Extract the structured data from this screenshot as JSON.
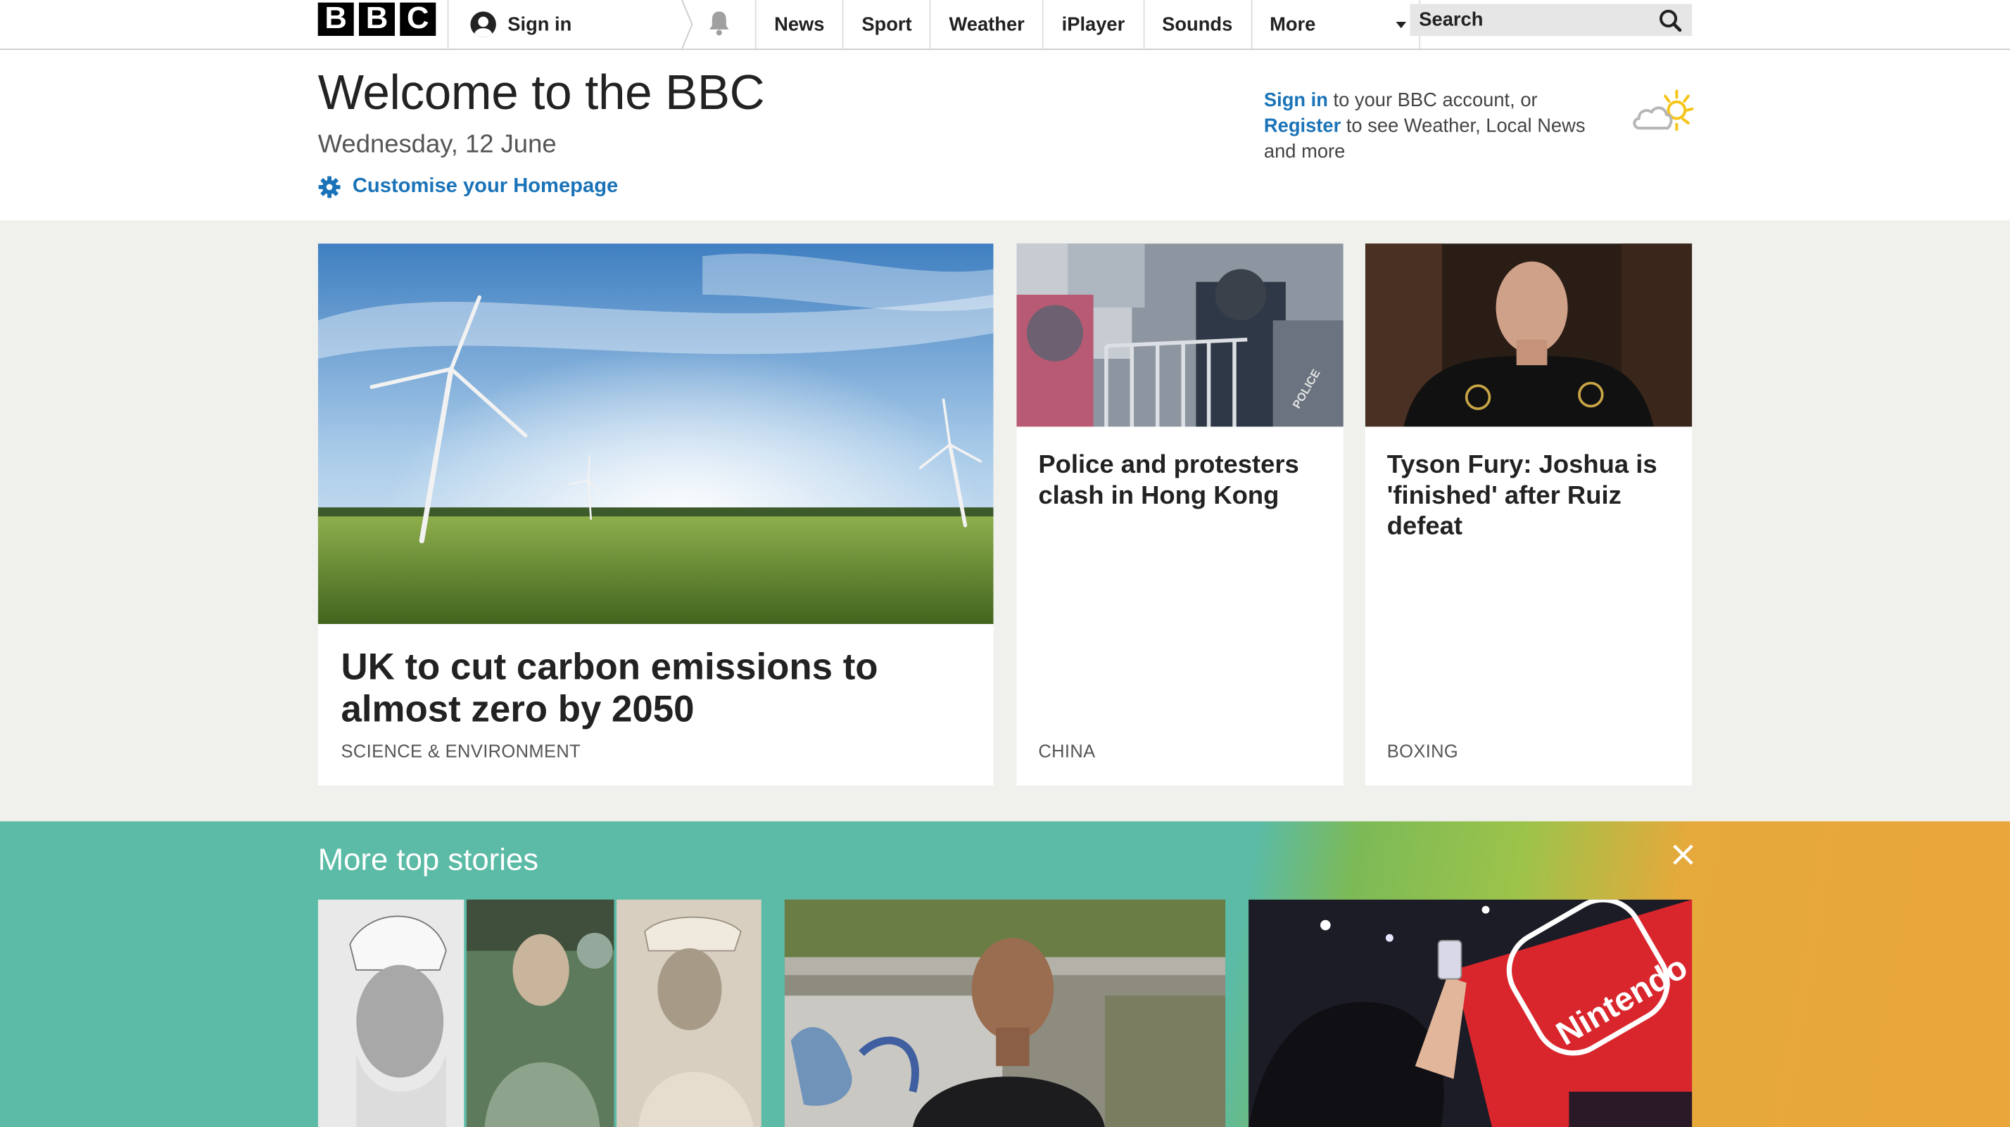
{
  "nav": {
    "logo_letters": [
      "B",
      "B",
      "C"
    ],
    "sign_in": "Sign in",
    "links": [
      "News",
      "Sport",
      "Weather",
      "iPlayer",
      "Sounds"
    ],
    "more": "More",
    "search_placeholder": "Search"
  },
  "welcome": {
    "title": "Welcome to the BBC",
    "date": "Wednesday, 12 June",
    "customise": "Customise your Homepage"
  },
  "account": {
    "sign_in": "Sign in",
    "text1": " to your BBC account, or",
    "register": "Register",
    "text2": " to see Weather, Local News and more"
  },
  "stories": [
    {
      "headline": "UK to cut carbon emissions to almost zero by 2050",
      "tag": "SCIENCE & ENVIRONMENT"
    },
    {
      "headline": "Police and protesters clash in Hong Kong",
      "tag": "CHINA"
    },
    {
      "headline": "Tyson Fury: Joshua is 'finished' after Ruiz defeat",
      "tag": "BOXING"
    }
  ],
  "more_top_stories": {
    "title": "More top stories",
    "image_texts": {
      "nintendo": "Nintendo",
      "police": "POLICE"
    }
  },
  "colors": {
    "link_blue": "#1a73b8",
    "grey_band": "#f0f0ec",
    "teal": "#5bbba6",
    "orange": "#eaa53b"
  }
}
